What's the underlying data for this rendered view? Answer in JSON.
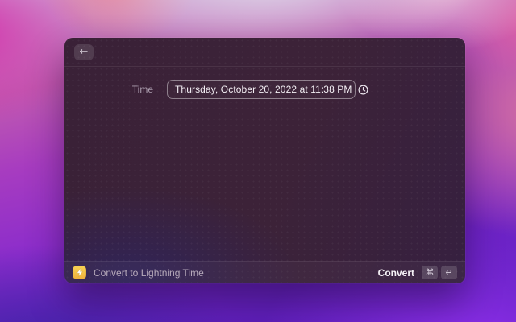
{
  "window": {
    "header": {
      "back_icon": "←"
    },
    "form": {
      "label": "Time",
      "value": "Thursday, October 20, 2022 at 11:38 PM"
    },
    "footer": {
      "command_name": "Convert to Lightning Time",
      "action_label": "Convert",
      "shortcut_keys": [
        "⌘",
        "↵"
      ]
    },
    "colors": {
      "command_icon_gold": "#f2b944",
      "field_border": "rgba(255,255,255,0.42)",
      "window_tint_top": "#3a2137",
      "window_tint_bottom": "#2f245c"
    }
  }
}
